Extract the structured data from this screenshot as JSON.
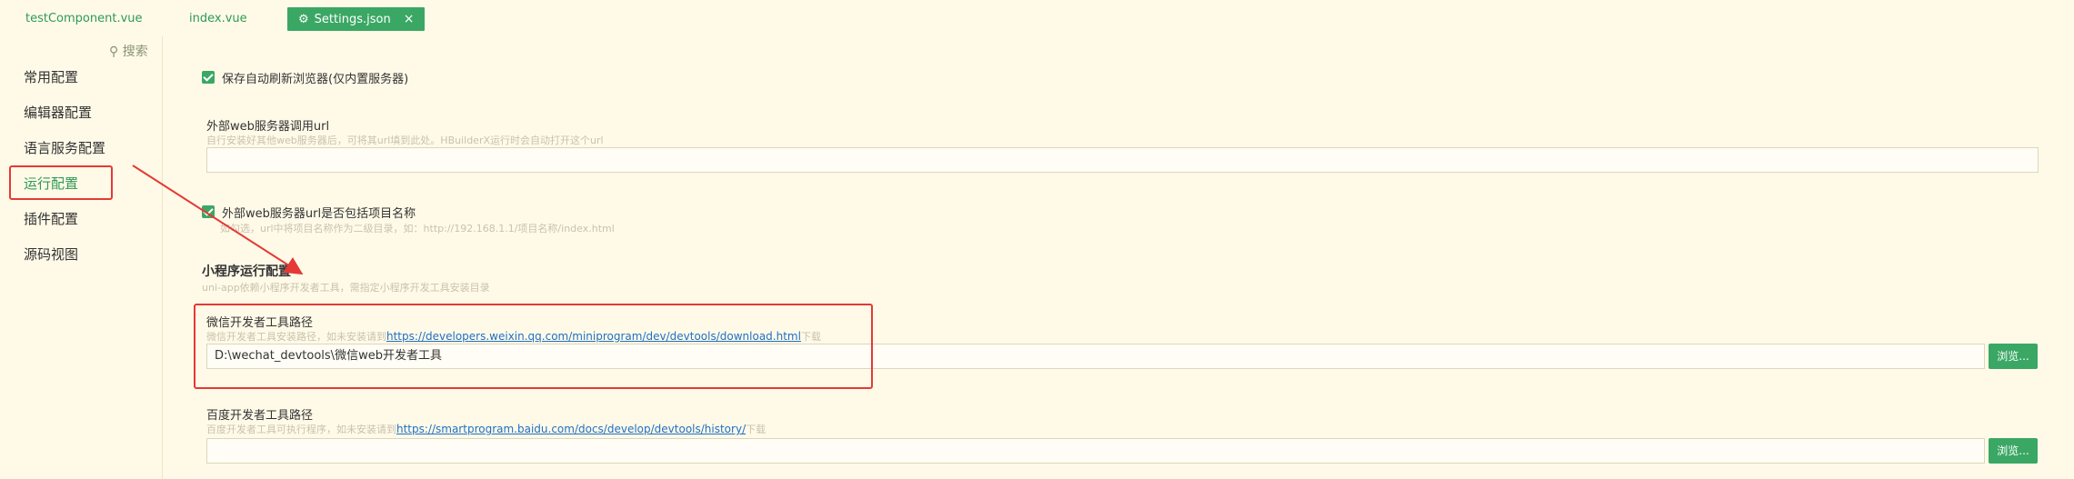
{
  "tabs": [
    {
      "label": "testComponent.vue"
    },
    {
      "label": "index.vue"
    },
    {
      "label": "Settings.json",
      "close": "×"
    }
  ],
  "sidebar": {
    "search_label": "搜索",
    "items": [
      {
        "label": "常用配置"
      },
      {
        "label": "编辑器配置"
      },
      {
        "label": "语言服务配置"
      },
      {
        "label": "运行配置",
        "active": true
      },
      {
        "label": "插件配置"
      },
      {
        "label": "源码视图"
      }
    ]
  },
  "main": {
    "auto_refresh": {
      "label": "保存自动刷新浏览器(仅内置服务器)",
      "checked": true
    },
    "web_server_url": {
      "label": "外部web服务器调用url",
      "hint": "自行安装好其他web服务器后，可将其url填到此处。HBuilderX运行时会自动打开这个url",
      "value": ""
    },
    "include_project": {
      "label": "外部web服务器url是否包括项目名称",
      "hint": "如勾选，url中将项目名称作为二级目录，如：http://192.168.1.1/项目名称/index.html",
      "checked": true
    },
    "mini_section": {
      "title": "小程序运行配置",
      "hint": "uni-app依赖小程序开发者工具，需指定小程序开发工具安装目录"
    },
    "wechat": {
      "label": "微信开发者工具路径",
      "hint_prefix": "微信开发者工具安装路径，如未安装请到",
      "link": "https://developers.weixin.qq.com/miniprogram/dev/devtools/download.html",
      "hint_suffix": "下载",
      "value": "D:\\wechat_devtools\\微信web开发者工具",
      "browse": "浏览..."
    },
    "baidu": {
      "label": "百度开发者工具路径",
      "hint_prefix": "百度开发者工具可执行程序，如未安装请到",
      "link": "https://smartprogram.baidu.com/docs/develop/devtools/history/",
      "hint_suffix": "下载",
      "value": "",
      "browse": "浏览..."
    }
  },
  "colors": {
    "accent": "#3ba765",
    "highlight": "#e53935",
    "background": "#fffae8",
    "link": "#1f6fc5"
  }
}
